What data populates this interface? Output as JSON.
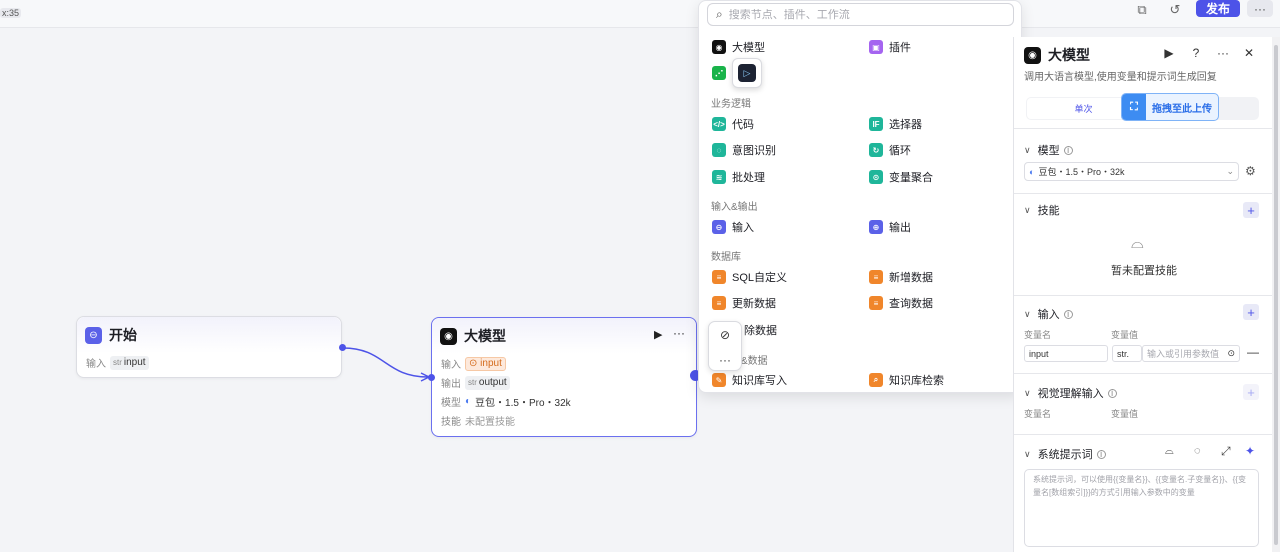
{
  "topbar": {
    "time_fragment": "x:35",
    "publish_label": "发布",
    "more_label": "···"
  },
  "canvas": {
    "start_node": {
      "title": "开始",
      "rows": [
        {
          "label": "输入",
          "type": "str",
          "value": "input"
        }
      ]
    },
    "llm_node": {
      "title": "大模型",
      "rows": [
        {
          "label": "输入",
          "value": "input"
        },
        {
          "label": "输出",
          "type": "str",
          "value": "output"
        },
        {
          "label": "模型",
          "value": "豆包・1.5・Pro・32k"
        },
        {
          "label": "技能",
          "value": "未配置技能"
        }
      ]
    }
  },
  "picker": {
    "search_placeholder": "搜索节点、插件、工作流",
    "top_items": [
      {
        "label": "大模型",
        "icon": "llm-icon",
        "color": "#111111"
      },
      {
        "label": "插件",
        "icon": "plugin-icon",
        "color": "#a564f0"
      }
    ],
    "sections": [
      {
        "title": "业务逻辑",
        "items": [
          {
            "label": "代码",
            "icon": "code-icon",
            "color": "#1fb69a"
          },
          {
            "label": "选择器",
            "icon": "if-icon",
            "color": "#1fb69a"
          },
          {
            "label": "意图识别",
            "icon": "intent-icon",
            "color": "#1fb69a"
          },
          {
            "label": "循环",
            "icon": "loop-icon",
            "color": "#1fb69a"
          },
          {
            "label": "批处理",
            "icon": "batch-icon",
            "color": "#1fb69a"
          },
          {
            "label": "变量聚合",
            "icon": "aggregate-icon",
            "color": "#1fb69a"
          }
        ]
      },
      {
        "title": "输入&输出",
        "items": [
          {
            "label": "输入",
            "icon": "input-icon",
            "color": "#5b61e8"
          },
          {
            "label": "输出",
            "icon": "output-icon",
            "color": "#5b61e8"
          }
        ]
      },
      {
        "title": "数据库",
        "items": [
          {
            "label": "SQL自定义",
            "icon": "sql-icon",
            "color": "#f0862b"
          },
          {
            "label": "新增数据",
            "icon": "db-add-icon",
            "color": "#f0862b"
          },
          {
            "label": "更新数据",
            "icon": "db-update-icon",
            "color": "#f0862b"
          },
          {
            "label": "查询数据",
            "icon": "db-query-icon",
            "color": "#f0862b"
          },
          {
            "label": "除数据",
            "icon": "db-delete-icon",
            "color": "#f0862b"
          }
        ]
      },
      {
        "title": "&数据",
        "items": [
          {
            "label": "知识库写入",
            "icon": "kb-write-icon",
            "color": "#f0862b"
          },
          {
            "label": "知识库检索",
            "icon": "kb-search-icon",
            "color": "#f0862b"
          }
        ]
      }
    ]
  },
  "panel": {
    "title": "大模型",
    "description": "调用大语言模型,使用变量和提示词生成回复",
    "mode_tab": "单次",
    "upload_chip": "拖拽至此上传",
    "model_section": "模型",
    "model_value": "豆包・1.5・Pro・32k",
    "skills_section": "技能",
    "skills_empty": "暂未配置技能",
    "input_section": "输入",
    "col_name": "变量名",
    "col_value": "变量值",
    "input_name": "input",
    "input_type": "str.",
    "input_value_placeholder": "输入或引用参数值",
    "vision_section": "视觉理解输入",
    "vision_col_name": "变量名",
    "vision_col_value": "变量值",
    "system_prompt_section": "系统提示词",
    "system_prompt_placeholder": "系统提示词，可以使用{{变量名}}、{{变量名.子变量名}}、{{变量名[数组索引]}}的方式引用输入参数中的变量"
  }
}
